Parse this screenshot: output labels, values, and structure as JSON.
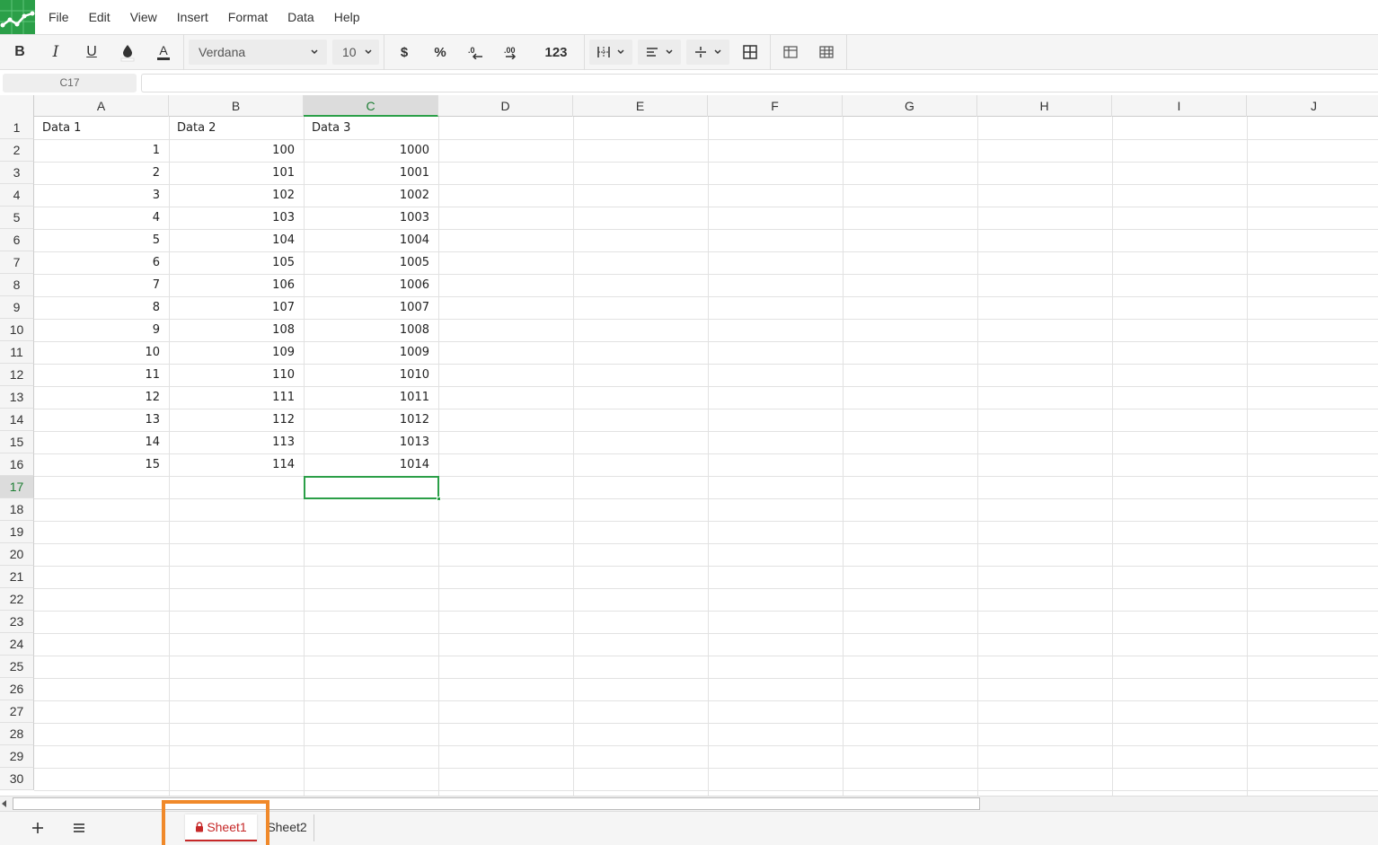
{
  "app": {
    "accent": "#2b9f48",
    "logo_icon": "spreadsheet-logo-icon"
  },
  "menu": [
    "File",
    "Edit",
    "View",
    "Insert",
    "Format",
    "Data",
    "Help"
  ],
  "toolbar": {
    "bold": "B",
    "italic": "I",
    "underline": "U",
    "font_family": "Verdana",
    "font_size": "10",
    "currency": "$",
    "percent": "%",
    "number_format": "123"
  },
  "formula_bar": {
    "cell_ref": "C17",
    "value": ""
  },
  "columns": [
    "A",
    "B",
    "C",
    "D",
    "E",
    "F",
    "G",
    "H",
    "I",
    "J"
  ],
  "active_column": "C",
  "rows": [
    "1",
    "2",
    "3",
    "4",
    "5",
    "6",
    "7",
    "8",
    "9",
    "10",
    "11",
    "12",
    "13",
    "14",
    "15",
    "16",
    "17",
    "18",
    "19",
    "20",
    "21",
    "22",
    "23",
    "24",
    "25",
    "26",
    "27",
    "28",
    "29",
    "30"
  ],
  "active_row": "17",
  "headers": [
    "Data 1",
    "Data 2",
    "Data 3"
  ],
  "data": [
    [
      "1",
      "100",
      "1000"
    ],
    [
      "2",
      "101",
      "1001"
    ],
    [
      "3",
      "102",
      "1002"
    ],
    [
      "4",
      "103",
      "1003"
    ],
    [
      "5",
      "104",
      "1004"
    ],
    [
      "6",
      "105",
      "1005"
    ],
    [
      "7",
      "106",
      "1006"
    ],
    [
      "8",
      "107",
      "1007"
    ],
    [
      "9",
      "108",
      "1008"
    ],
    [
      "10",
      "109",
      "1009"
    ],
    [
      "11",
      "110",
      "1010"
    ],
    [
      "12",
      "111",
      "1011"
    ],
    [
      "13",
      "112",
      "1012"
    ],
    [
      "14",
      "113",
      "1013"
    ],
    [
      "15",
      "114",
      "1014"
    ]
  ],
  "sheets": [
    {
      "name": "Sheet1",
      "active": true,
      "locked": true
    },
    {
      "name": "Sheet2",
      "active": false,
      "locked": false
    }
  ],
  "highlight_color": "#f0892a",
  "active_tab_color": "#c62828"
}
